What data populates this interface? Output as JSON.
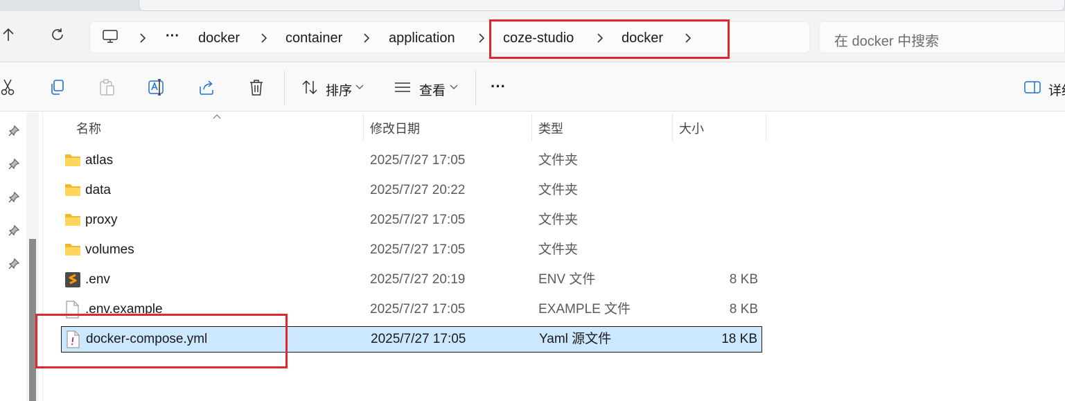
{
  "breadcrumb": {
    "overflow": "···",
    "items": [
      "docker",
      "container",
      "application",
      "coze-studio",
      "docker"
    ]
  },
  "search": {
    "placeholder": "在 docker 中搜索"
  },
  "toolbar": {
    "sort_label": "排序",
    "view_label": "查看",
    "more_label": "···",
    "details_label": "详细"
  },
  "columns": {
    "name": "名称",
    "modified": "修改日期",
    "type": "类型",
    "size": "大小"
  },
  "files": [
    {
      "name": "atlas",
      "modified": "2025/7/27 17:05",
      "type": "文件夹",
      "size": "",
      "icon": "folder-icon"
    },
    {
      "name": "data",
      "modified": "2025/7/27 20:22",
      "type": "文件夹",
      "size": "",
      "icon": "folder-icon"
    },
    {
      "name": "proxy",
      "modified": "2025/7/27 17:05",
      "type": "文件夹",
      "size": "",
      "icon": "folder-icon"
    },
    {
      "name": "volumes",
      "modified": "2025/7/27 17:05",
      "type": "文件夹",
      "size": "",
      "icon": "folder-icon"
    },
    {
      "name": ".env",
      "modified": "2025/7/27 20:19",
      "type": "ENV 文件",
      "size": "8 KB",
      "icon": "sublime-file-icon"
    },
    {
      "name": ".env.example",
      "modified": "2025/7/27 17:05",
      "type": "EXAMPLE 文件",
      "size": "8 KB",
      "icon": "blank-file-icon"
    },
    {
      "name": "docker-compose.yml",
      "modified": "2025/7/27 17:05",
      "type": "Yaml 源文件",
      "size": "18 KB",
      "icon": "yaml-file-icon",
      "selected": true
    }
  ],
  "colors": {
    "highlight": "#e0262f",
    "selection": "#cce8ff",
    "folder": "#f7c948"
  }
}
